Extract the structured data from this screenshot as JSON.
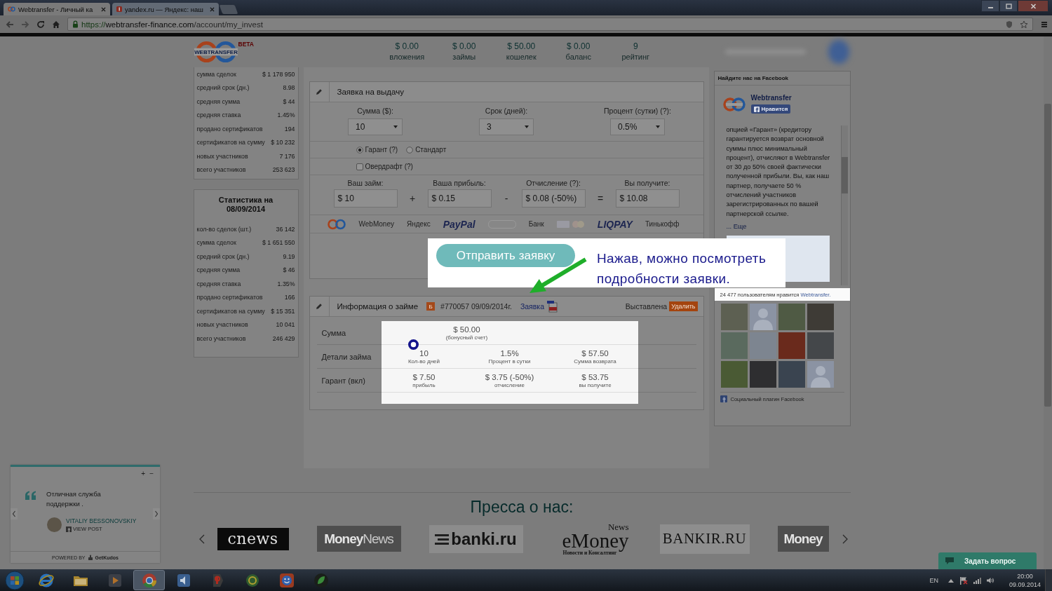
{
  "browser": {
    "tabs": [
      {
        "title": "Webtransfer - Личный ка",
        "selected": true
      },
      {
        "title": "yandex.ru — Яндекс: наш",
        "selected": false
      }
    ],
    "url": {
      "scheme": "https://",
      "host": "webtransfer-finance.com",
      "path": "/account/my_invest"
    }
  },
  "header": {
    "logo_text": "WEBTRANSFER",
    "logo_badge": "BETA",
    "stats": [
      {
        "value": "$ 0.00",
        "label": "вложения"
      },
      {
        "value": "$ 0.00",
        "label": "займы"
      },
      {
        "value": "$ 50.00",
        "label": "кошелек"
      },
      {
        "value": "$ 0.00",
        "label": "баланс"
      },
      {
        "value": "9",
        "label": "рейтинг"
      }
    ]
  },
  "sidebar": [
    {
      "rows": [
        {
          "label": "сумма сделок",
          "value": "$ 1 178 950"
        },
        {
          "label": "средний срок (дн.)",
          "value": "8.98"
        },
        {
          "label": "средняя сумма",
          "value": "$ 44"
        },
        {
          "label": "средняя ставка",
          "value": "1.45%"
        },
        {
          "label": "продано сертификатов",
          "value": "194"
        },
        {
          "label": "сертификатов на сумму",
          "value": "$ 10 232"
        },
        {
          "label": "новых участников",
          "value": "7 176"
        },
        {
          "label": "всего участников",
          "value": "253 623"
        }
      ]
    },
    {
      "title": "Статистика на 08/09/2014",
      "rows": [
        {
          "label": "кол-во сделок (шт.)",
          "value": "36 142"
        },
        {
          "label": "сумма сделок",
          "value": "$ 1 651 550"
        },
        {
          "label": "средний срок (дн.)",
          "value": "9.19"
        },
        {
          "label": "средняя сумма",
          "value": "$ 46"
        },
        {
          "label": "средняя ставка",
          "value": "1.35%"
        },
        {
          "label": "продано сертификатов",
          "value": "166"
        },
        {
          "label": "сертификатов на сумму",
          "value": "$ 15 351"
        },
        {
          "label": "новых участников",
          "value": "10 041"
        },
        {
          "label": "всего участников",
          "value": "246 429"
        }
      ]
    }
  ],
  "order_form": {
    "title": "Заявка на выдачу",
    "selects": [
      {
        "label": "Сумма ($):",
        "value": "10"
      },
      {
        "label": "Срок (дней):",
        "value": "3"
      },
      {
        "label": "Процент (сутки) (?):",
        "value": "0.5%"
      }
    ],
    "loan_types": [
      {
        "label": "Гарант (?)",
        "selected": true
      },
      {
        "label": "Стандарт",
        "selected": false
      }
    ],
    "overdraft": {
      "label": "Овердрафт (?)",
      "checked": false
    },
    "calculation": [
      {
        "label": "Ваш займ:",
        "value": "$ 10"
      },
      {
        "label": "Ваша прибыль:",
        "value": "$ 0.15"
      },
      {
        "label": "Отчисление (?):",
        "value": "$ 0.08 (-50%)"
      },
      {
        "label": "Вы получите:",
        "value": "$ 10.08"
      }
    ],
    "operators": [
      "+",
      "-",
      "="
    ],
    "payment_logos": [
      {
        "kind": "rings"
      },
      {
        "kind": "text",
        "text": "WebMoney"
      },
      {
        "kind": "text",
        "text": "Яндекс"
      },
      {
        "kind": "brand",
        "text": "PayPal"
      },
      {
        "kind": "blank"
      },
      {
        "kind": "text",
        "text": "Банк"
      },
      {
        "kind": "cards"
      },
      {
        "kind": "brand",
        "text": "LIQPAY"
      },
      {
        "kind": "text",
        "text": "Тинькофф"
      }
    ],
    "submit_button": "Отправить заявку"
  },
  "annotation": "Нажав, можно посмотреть подробности заявки.",
  "loan_info": {
    "title": "Информация о займе",
    "badge": "Б",
    "number": "#770057 09/09/2014г.",
    "link": "Заявка",
    "status": "Выставлена",
    "delete_button": "Удалить",
    "row_labels": [
      "Сумма",
      "Детали займа",
      "Гарант (вкл)"
    ],
    "details": [
      [
        {
          "value": "$ 50.00",
          "caption": "(бонусный счет)"
        }
      ],
      [
        {
          "value": "10",
          "caption": "Кол-во дней"
        },
        {
          "value": "1.5%",
          "caption": "Процент в сутки"
        },
        {
          "value": "$ 57.50",
          "caption": "Сумма возврата"
        }
      ],
      [
        {
          "value": "$ 7.50",
          "caption": "прибыль"
        },
        {
          "value": "$ 3.75 (-50%)",
          "caption": "отчисление"
        },
        {
          "value": "$ 53.75",
          "caption": "вы получите"
        }
      ]
    ]
  },
  "facebook": {
    "title": "Найдите нас на Facebook",
    "page_name": "Webtransfer",
    "like_button": "Нравится",
    "post_text": "опцией «Гарант» (кредитору гарантируется возврат основной суммы плюс минимальный процент), отчисляют в Webtransfer от 30 до 50% своей фактически полученной прибыли. Вы, как наш партнер, получаете 50 % отчислений участников зарегистрированных по вашей партнерской ссылке.",
    "more_link": "... Еще",
    "likes_text": "24 477 пользователям нравится",
    "likes_link": "Webtransfer.",
    "avatars": [
      {
        "kind": "photo"
      },
      {
        "kind": "silhouette"
      },
      {
        "kind": "photo"
      },
      {
        "kind": "photo"
      },
      {
        "kind": "photo"
      },
      {
        "kind": "photo"
      },
      {
        "kind": "photo"
      },
      {
        "kind": "photo"
      },
      {
        "kind": "photo"
      },
      {
        "kind": "photo"
      },
      {
        "kind": "photo"
      },
      {
        "kind": "silhouette"
      }
    ],
    "footer": "Социальный плагин Facebook"
  },
  "press": {
    "title": "Пресса о нас:",
    "logos": [
      {
        "kind": "cnews",
        "text": "cnews"
      },
      {
        "kind": "money",
        "text": "Money",
        "extra": "News"
      },
      {
        "kind": "banki",
        "text": "banki.ru"
      },
      {
        "kind": "emoney",
        "text": "eMoney",
        "extra": "News",
        "sub": "Новости и Консалтинг"
      },
      {
        "kind": "bankir",
        "text": "BANKIR.RU"
      },
      {
        "kind": "money",
        "text": "Money"
      }
    ]
  },
  "reviews": {
    "controls": [
      "+",
      "−"
    ],
    "text": "Отличная служба поддержки .",
    "author": "VITALIY BESSONOVSKIY",
    "view_post": "VIEW POST",
    "powered_by": "POWERED BY",
    "brand": "GetKudos"
  },
  "chat_button": "Задать вопрос",
  "taskbar": {
    "apps": [
      {
        "kind": "ie",
        "selected": false
      },
      {
        "kind": "explorer",
        "selected": false
      },
      {
        "kind": "media",
        "selected": false
      },
      {
        "kind": "chrome",
        "selected": true
      },
      {
        "kind": "speaker",
        "selected": false
      },
      {
        "kind": "yandex",
        "selected": false
      },
      {
        "kind": "globe",
        "selected": false
      },
      {
        "kind": "face",
        "selected": false
      },
      {
        "kind": "leaf",
        "selected": false
      }
    ],
    "language": "EN",
    "time": "20:00",
    "date": "09.09.2014"
  }
}
